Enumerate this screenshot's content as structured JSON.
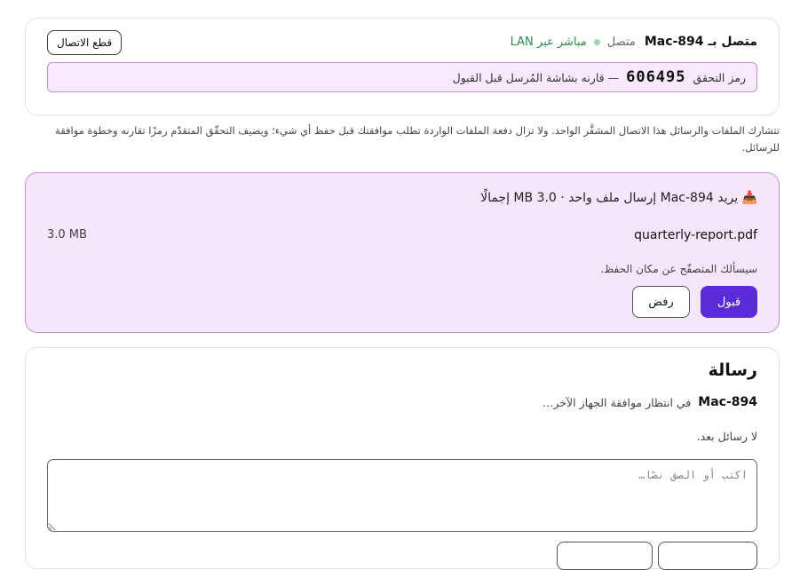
{
  "connection": {
    "title": "متصل بـ Mac-894",
    "status": "متصل",
    "transport": "مباشر عبر LAN",
    "disconnect_label": "قطع الاتصال",
    "verify_label": "رمز التحقق",
    "verify_code": "606495",
    "verify_hint": "— قارنه بشاشة المُرسل قبل القبول"
  },
  "intro_text": "تتشارك الملفات والرسائل هذا الاتصال المشفَّر الواحد. ولا تزال دفعة الملفات الواردة تطلب موافقتك قبل حفظ أي شيء؛ ويضيف التحقّق المتقدّم رمزًا تقارنه وخطوة موافقة للرسائل.",
  "offer": {
    "icon": "inbox-tray-icon",
    "title": "يريد Mac-894 إرسال ملف واحد · 3.0 MB إجمالًا",
    "file_name": "quarterly-report.pdf",
    "file_size": "3.0 MB",
    "save_hint": "سيسألك المتصفّح عن مكان الحفظ.",
    "accept_label": "قبول",
    "reject_label": "رفض"
  },
  "messages": {
    "title": "رسالة",
    "peer_name": "Mac-894",
    "peer_status": "في انتظار موافقة الجهاز الآخر…",
    "empty_text": "لا رسائل بعد.",
    "input_placeholder": "اكتب أو الصق نصًا…",
    "input_value": ""
  },
  "colors": {
    "accent": "#5b2bd6",
    "offer_background": "#f6e6fb",
    "status_dot": "#9fd3b1",
    "lan_text": "#2a8a4a"
  }
}
